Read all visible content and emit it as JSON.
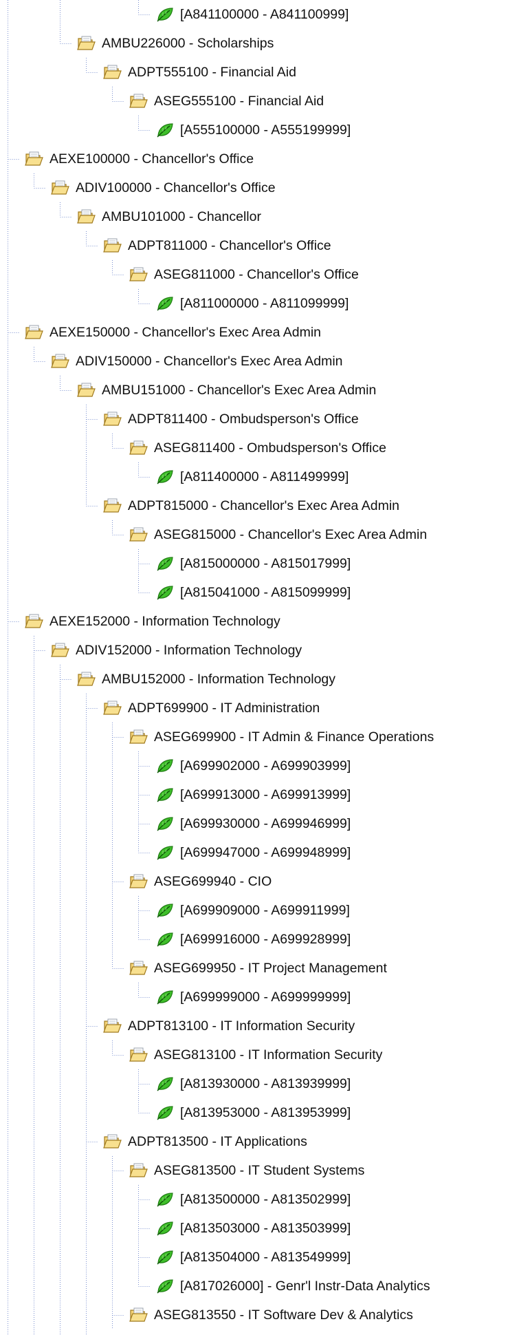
{
  "tree": {
    "nodes": [
      {
        "level": 5,
        "type": "range",
        "label": "[A841100000 - A841100999]"
      },
      {
        "level": 2,
        "type": "folder",
        "label": "AMBU226000 - Scholarships"
      },
      {
        "level": 3,
        "type": "folder",
        "label": "ADPT555100 - Financial Aid"
      },
      {
        "level": 4,
        "type": "folder",
        "label": "ASEG555100 - Financial Aid"
      },
      {
        "level": 5,
        "type": "range",
        "label": "[A555100000 - A555199999]"
      },
      {
        "level": 0,
        "type": "folder",
        "label": "AEXE100000 - Chancellor's Office"
      },
      {
        "level": 1,
        "type": "folder",
        "label": "ADIV100000 - Chancellor's Office"
      },
      {
        "level": 2,
        "type": "folder",
        "label": "AMBU101000 - Chancellor"
      },
      {
        "level": 3,
        "type": "folder",
        "label": "ADPT811000 - Chancellor's Office"
      },
      {
        "level": 4,
        "type": "folder",
        "label": "ASEG811000 - Chancellor's Office"
      },
      {
        "level": 5,
        "type": "range",
        "label": "[A811000000 - A811099999]"
      },
      {
        "level": 0,
        "type": "folder",
        "label": "AEXE150000 - Chancellor's Exec Area Admin"
      },
      {
        "level": 1,
        "type": "folder",
        "label": "ADIV150000 - Chancellor's Exec Area Admin"
      },
      {
        "level": 2,
        "type": "folder",
        "label": "AMBU151000 - Chancellor's Exec Area Admin"
      },
      {
        "level": 3,
        "type": "folder",
        "label": "ADPT811400 - Ombudsperson's Office"
      },
      {
        "level": 4,
        "type": "folder",
        "label": "ASEG811400 - Ombudsperson's Office"
      },
      {
        "level": 5,
        "type": "range",
        "label": "[A811400000 - A811499999]"
      },
      {
        "level": 3,
        "type": "folder",
        "label": "ADPT815000 - Chancellor's Exec Area Admin"
      },
      {
        "level": 4,
        "type": "folder",
        "label": "ASEG815000 - Chancellor's Exec Area Admin"
      },
      {
        "level": 5,
        "type": "range",
        "label": "[A815000000 - A815017999]"
      },
      {
        "level": 5,
        "type": "range",
        "label": "[A815041000 - A815099999]"
      },
      {
        "level": 0,
        "type": "folder",
        "label": "AEXE152000 - Information Technology"
      },
      {
        "level": 1,
        "type": "folder",
        "label": "ADIV152000 - Information Technology"
      },
      {
        "level": 2,
        "type": "folder",
        "label": "AMBU152000 - Information Technology"
      },
      {
        "level": 3,
        "type": "folder",
        "label": "ADPT699900 - IT Administration"
      },
      {
        "level": 4,
        "type": "folder",
        "label": "ASEG699900 - IT Admin & Finance Operations"
      },
      {
        "level": 5,
        "type": "range",
        "label": "[A699902000 - A699903999]"
      },
      {
        "level": 5,
        "type": "range",
        "label": "[A699913000 - A699913999]"
      },
      {
        "level": 5,
        "type": "range",
        "label": "[A699930000 - A699946999]"
      },
      {
        "level": 5,
        "type": "range",
        "label": "[A699947000 - A699948999]"
      },
      {
        "level": 4,
        "type": "folder",
        "label": "ASEG699940 - CIO"
      },
      {
        "level": 5,
        "type": "range",
        "label": "[A699909000 - A699911999]"
      },
      {
        "level": 5,
        "type": "range",
        "label": "[A699916000 - A699928999]"
      },
      {
        "level": 4,
        "type": "folder",
        "label": "ASEG699950 - IT Project Management"
      },
      {
        "level": 5,
        "type": "range",
        "label": "[A699999000 - A699999999]"
      },
      {
        "level": 3,
        "type": "folder",
        "label": "ADPT813100 - IT Information Security"
      },
      {
        "level": 4,
        "type": "folder",
        "label": "ASEG813100 - IT Information Security"
      },
      {
        "level": 5,
        "type": "range",
        "label": "[A813930000 - A813939999]"
      },
      {
        "level": 5,
        "type": "range",
        "label": "[A813953000 - A813953999]"
      },
      {
        "level": 3,
        "type": "folder",
        "label": "ADPT813500 - IT Applications"
      },
      {
        "level": 4,
        "type": "folder",
        "label": "ASEG813500 - IT Student Systems"
      },
      {
        "level": 5,
        "type": "range",
        "label": "[A813500000 - A813502999]"
      },
      {
        "level": 5,
        "type": "range",
        "label": "[A813503000 - A813503999]"
      },
      {
        "level": 5,
        "type": "range",
        "label": "[A813504000 - A813549999]"
      },
      {
        "level": 5,
        "type": "range",
        "label": "[A817026000] - Genr'l Instr-Data Analytics"
      },
      {
        "level": 4,
        "type": "folder",
        "label": "ASEG813550 - IT Software Dev & Analytics"
      }
    ]
  },
  "icons": {
    "folder": "open-folder-icon",
    "range": "leaf-icon"
  },
  "colors": {
    "guide": "#7a8fcf",
    "folder_fill": "#f5d57a",
    "folder_stroke": "#a07a1e",
    "leaf_fill": "#3fbf2a",
    "leaf_stroke": "#1f7a12"
  }
}
